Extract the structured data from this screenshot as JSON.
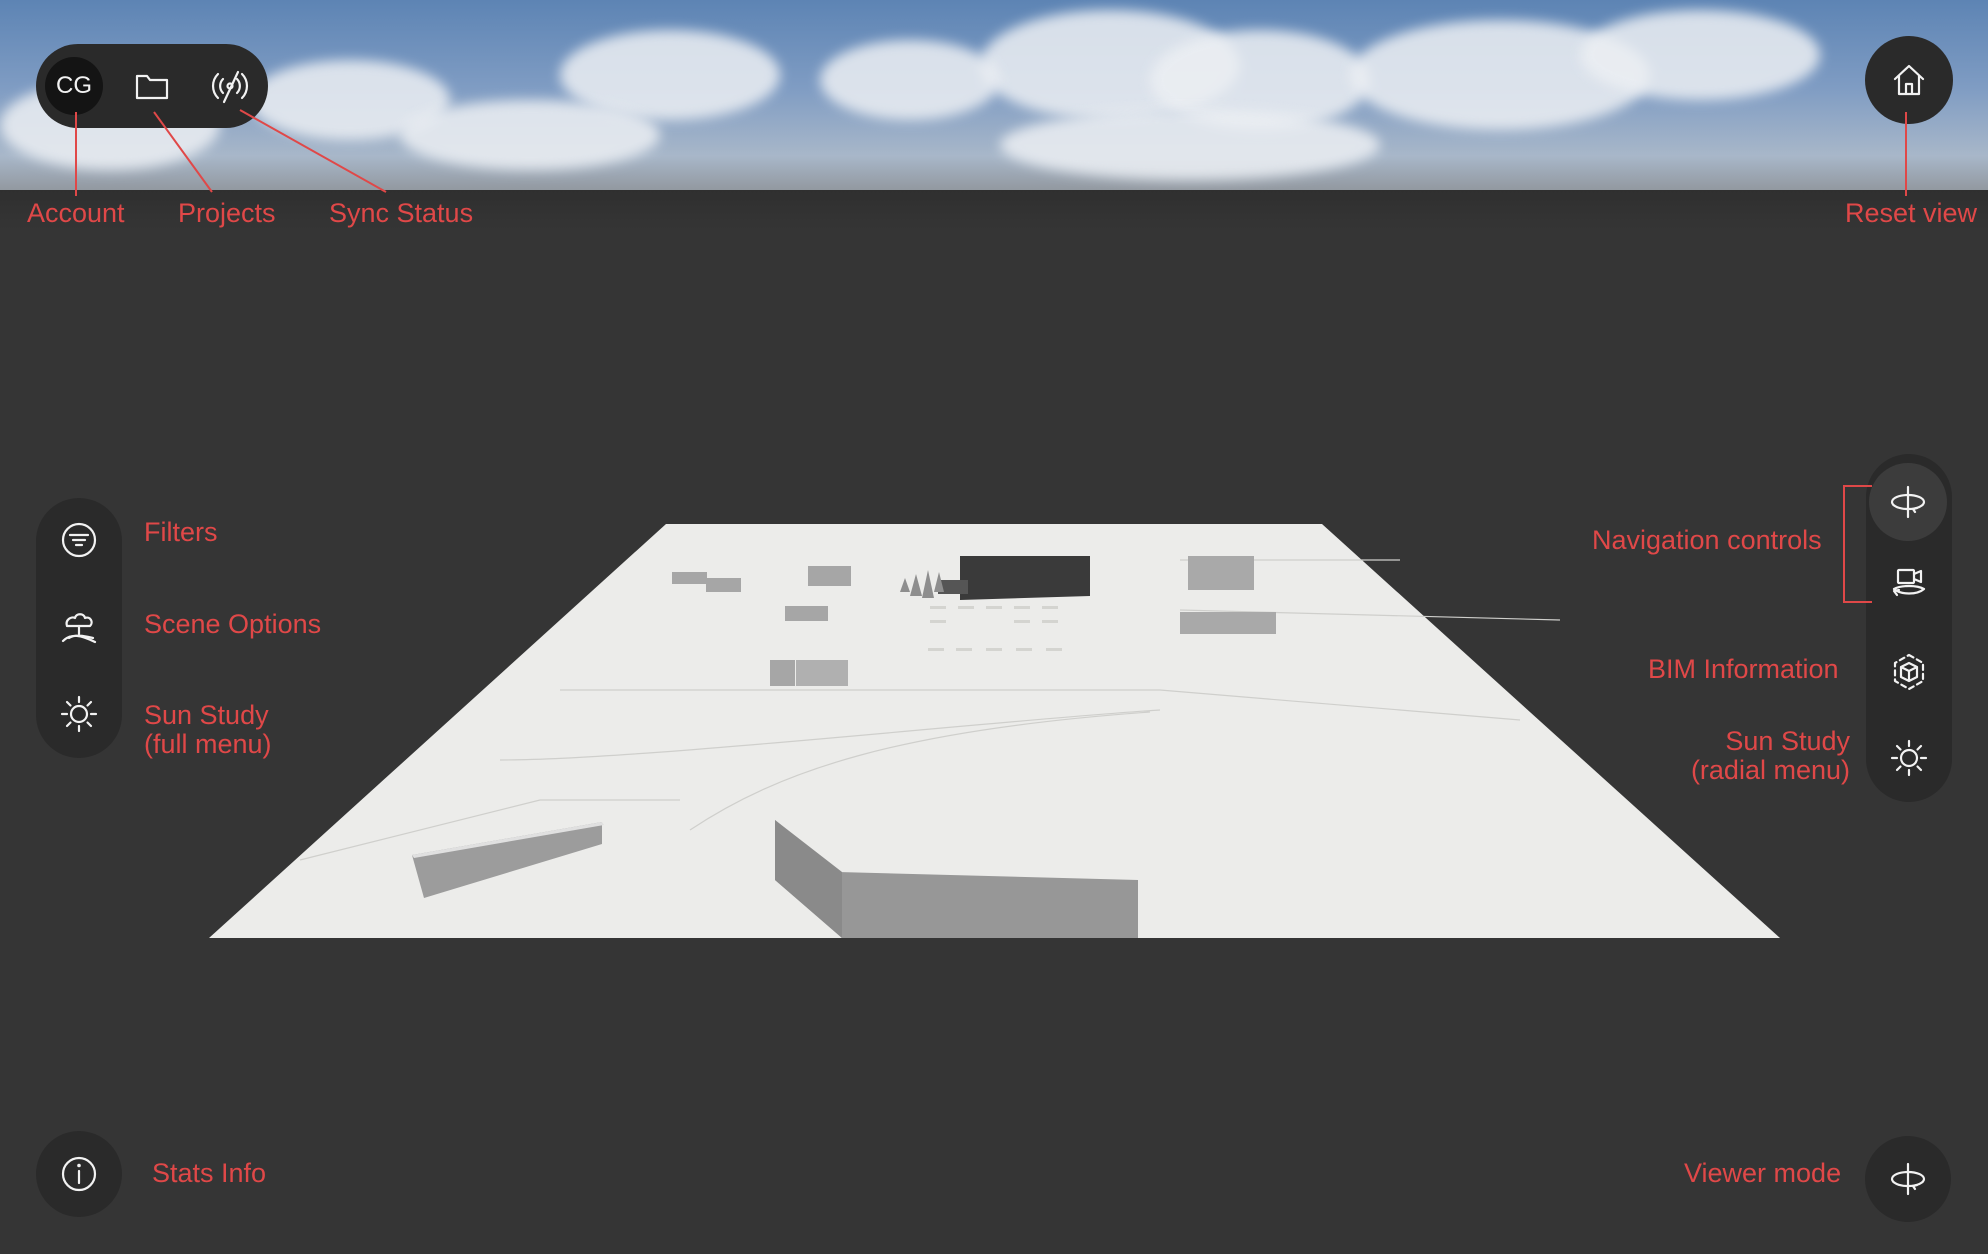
{
  "toolbar": {
    "avatar_initials": "CG",
    "icons": [
      "folder-icon",
      "sync-status-icon",
      "home-icon"
    ]
  },
  "left_panel": {
    "icons": [
      "filter-icon",
      "scene-options-icon",
      "sun-icon"
    ]
  },
  "right_panel": {
    "icons": [
      "orbit-icon",
      "camera-navigation-icon",
      "bim-cube-icon",
      "sun-icon"
    ]
  },
  "bottom": {
    "stats_icon": "info-icon",
    "viewer_mode_icon": "orbit-icon"
  },
  "annotations": {
    "account": "Account",
    "projects": "Projects",
    "sync_status": "Sync Status",
    "reset_view": "Reset view",
    "filters": "Filters",
    "scene_options": "Scene Options",
    "sun_study_full_1": "Sun Study",
    "sun_study_full_2": "(full menu)",
    "navigation_controls": "Navigation controls",
    "bim_information": "BIM Information",
    "sun_study_radial_1": "Sun Study",
    "sun_study_radial_2": "(radial menu)",
    "stats_info": "Stats Info",
    "viewer_mode": "Viewer mode"
  },
  "colors": {
    "annotation": "#e04848",
    "panel": "#2a2a2a",
    "background": "#353535",
    "ground": "#ececea"
  }
}
